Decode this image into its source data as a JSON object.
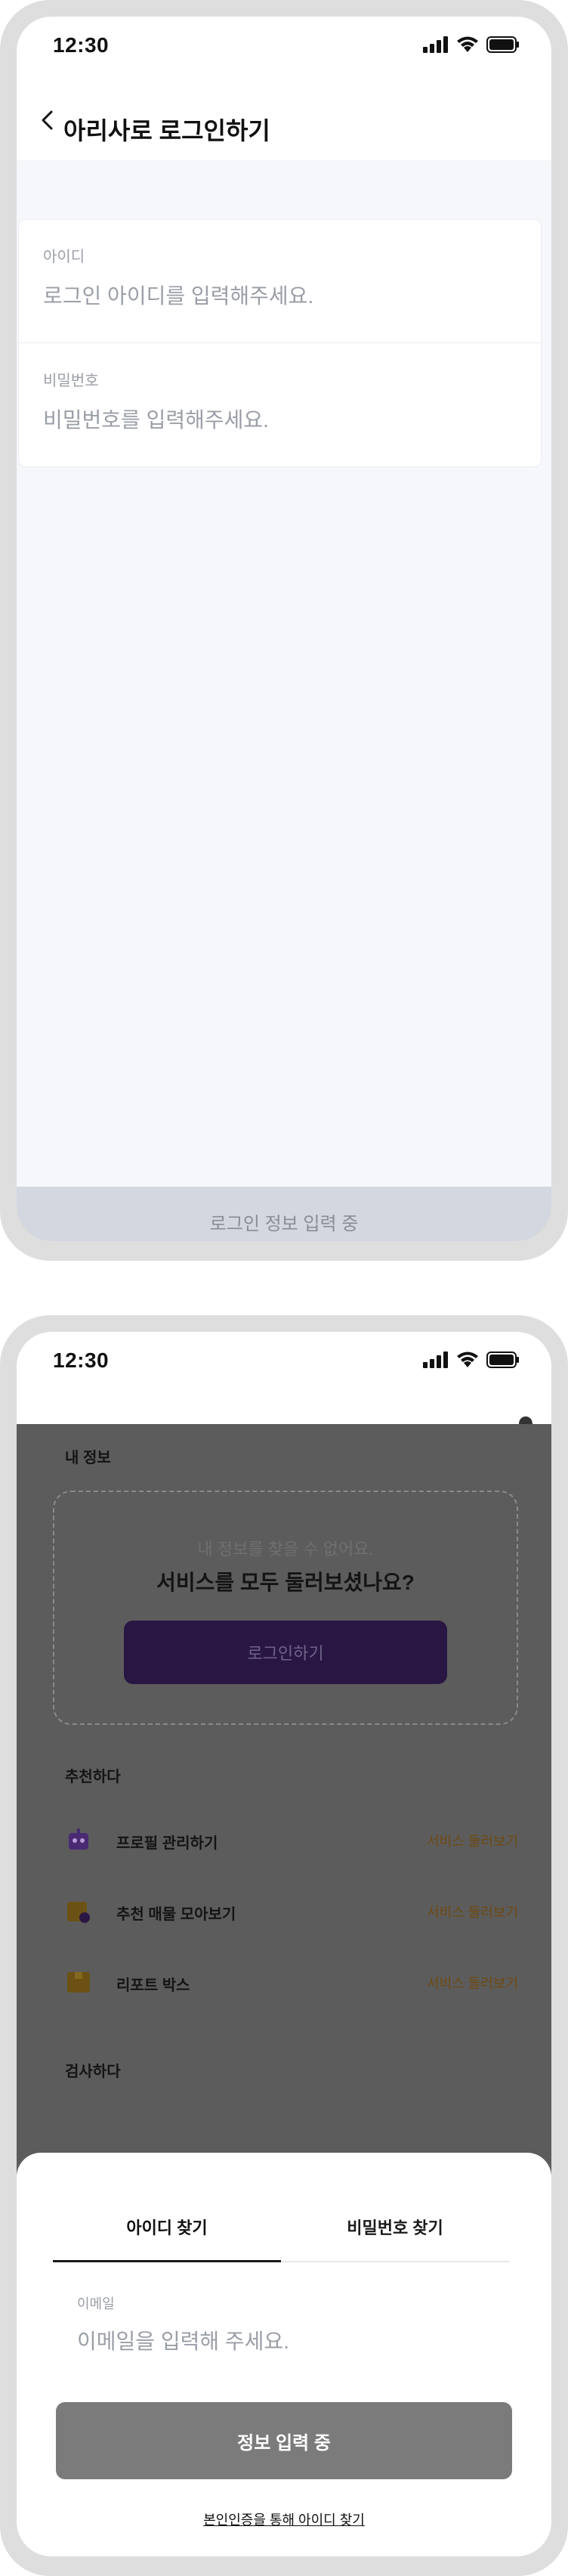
{
  "status": {
    "time": "12:30"
  },
  "login": {
    "title": "아리사로 로그인하기",
    "id_label": "아이디",
    "id_placeholder": "로그인 아이디를 입력해주세요.",
    "pw_label": "비밀번호",
    "pw_placeholder": "비밀번호를 입력해주세요.",
    "button": "로그인 정보 입력 중"
  },
  "mypage": {
    "my_info_title": "내 정보",
    "empty_sub": "내 정보를 찾을 수 없어요.",
    "empty_title": "서비스를 모두 둘러보셨나요?",
    "login_button": "로그인하기",
    "recommend_title": "추천하다",
    "recommend_items": [
      {
        "label": "프로필 관리하기",
        "link": "서비스 둘러보기",
        "icon": "robot-icon"
      },
      {
        "label": "추천 매물 모아보기",
        "link": "서비스 둘러보기",
        "icon": "search-box-icon"
      },
      {
        "label": "리포트 박스",
        "link": "서비스 둘러보기",
        "icon": "box-icon"
      }
    ],
    "search_title": "검사하다"
  },
  "sheet": {
    "tab_find_id": "아이디 찾기",
    "tab_find_pw": "비밀번호 찾기",
    "email_label": "이메일",
    "email_placeholder": "이메일을 입력해 주세요.",
    "button": "정보 입력 중",
    "verify_link": "본인인증을 통해 아이디 찾기"
  },
  "colors": {
    "accent_purple": "#2a1643",
    "link_orange": "#6e4a12",
    "background_grey": "#f5f7fa"
  }
}
